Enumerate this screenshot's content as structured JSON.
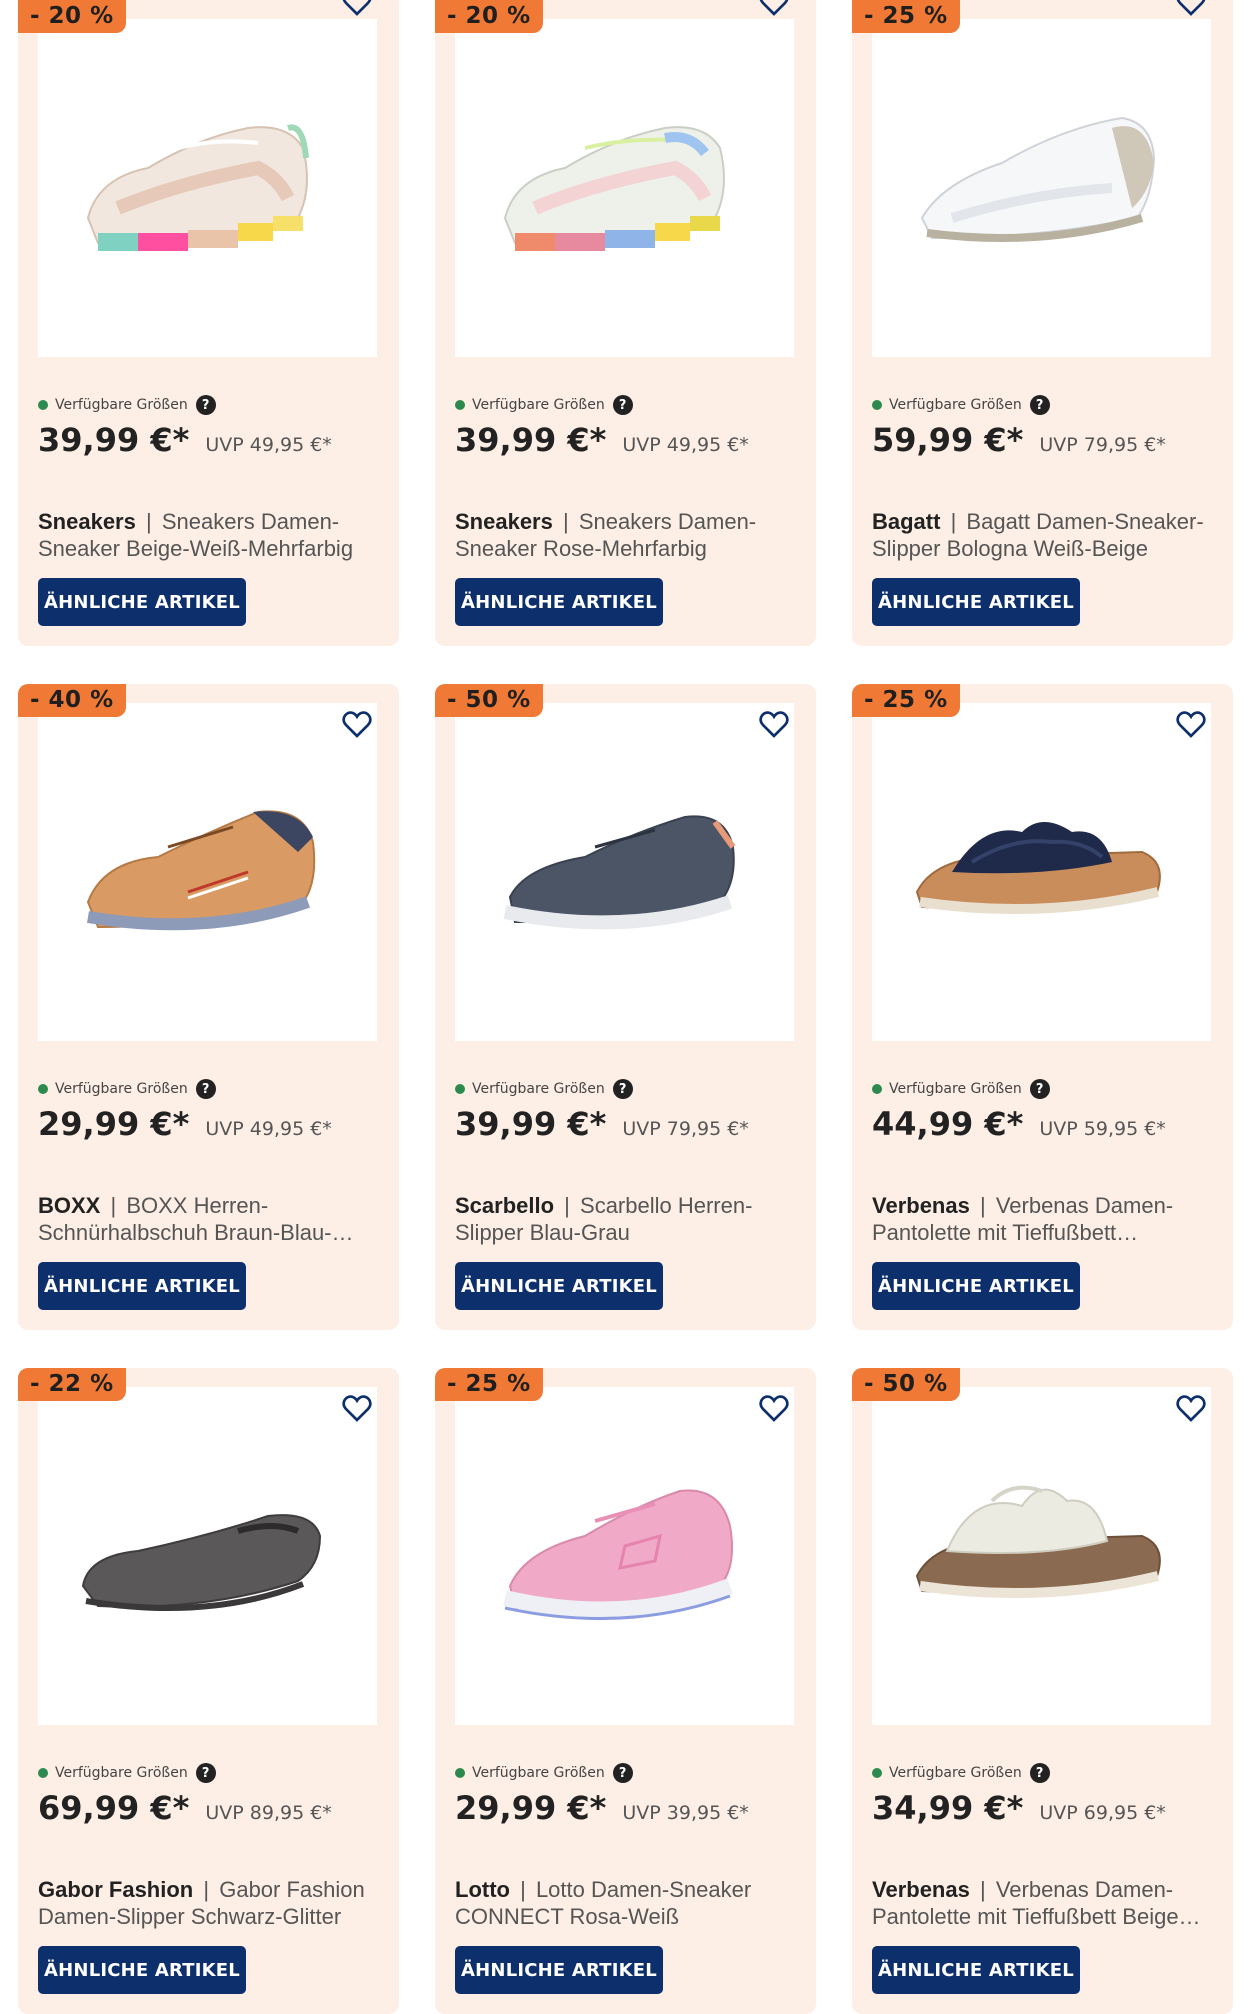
{
  "labels": {
    "available_sizes": "Verfügbare Größen",
    "help": "?",
    "similar_button": "ÄHNLICHE ARTIKEL",
    "separator": "|"
  },
  "products": [
    {
      "discount": "- 20 %",
      "price": "39,99 €*",
      "uvp": "UVP 49,95 €*",
      "brand": "Sneakers",
      "name": "Sneakers Damen-Sneaker Beige-Weiß-Mehrfarbig",
      "image": "shoe-sneaker-beige"
    },
    {
      "discount": "- 20 %",
      "price": "39,99 €*",
      "uvp": "UVP 49,95 €*",
      "brand": "Sneakers",
      "name": "Sneakers Damen-Sneaker Rose-Mehrfarbig",
      "image": "shoe-sneaker-rose"
    },
    {
      "discount": "- 25 %",
      "price": "59,99 €*",
      "uvp": "UVP 79,95 €*",
      "brand": "Bagatt",
      "name": "Bagatt Damen-Sneaker-Slipper Bologna Weiß-Beige",
      "image": "shoe-sneaker-white"
    },
    {
      "discount": "- 40 %",
      "price": "29,99 €*",
      "uvp": "UVP 49,95 €*",
      "brand": "BOXX",
      "name": "BOXX Herren-Schnürhalbschuh Braun-Blau-…",
      "image": "shoe-sneaker-brown"
    },
    {
      "discount": "- 50 %",
      "price": "39,99 €*",
      "uvp": "UVP 79,95 €*",
      "brand": "Scarbello",
      "name": "Scarbello Herren-Slipper Blau-Grau",
      "image": "shoe-sneaker-grey"
    },
    {
      "discount": "- 25 %",
      "price": "44,99 €*",
      "uvp": "UVP 59,95 €*",
      "brand": "Verbenas",
      "name": "Verbenas Damen-Pantolette mit Tieffußbett…",
      "image": "shoe-slide-navy"
    },
    {
      "discount": "- 22 %",
      "price": "69,99 €*",
      "uvp": "UVP 89,95 €*",
      "brand": "Gabor Fashion",
      "name": "Gabor Fashion Damen-Slipper Schwarz-Glitter",
      "image": "shoe-loafer-grey"
    },
    {
      "discount": "- 25 %",
      "price": "29,99 €*",
      "uvp": "UVP 39,95 €*",
      "brand": "Lotto",
      "name": "Lotto Damen-Sneaker CONNECT Rosa-Weiß",
      "image": "shoe-sneaker-pink"
    },
    {
      "discount": "- 50 %",
      "price": "34,99 €*",
      "uvp": "UVP 69,95 €*",
      "brand": "Verbenas",
      "name": "Verbenas Damen-Pantolette mit Tieffußbett Beige…",
      "image": "shoe-slide-beige"
    }
  ],
  "colors": {
    "card_bg": "#fdefe6",
    "badge": "#f07a35",
    "button": "#0d2f6b",
    "available_dot": "#2d8a4e"
  }
}
